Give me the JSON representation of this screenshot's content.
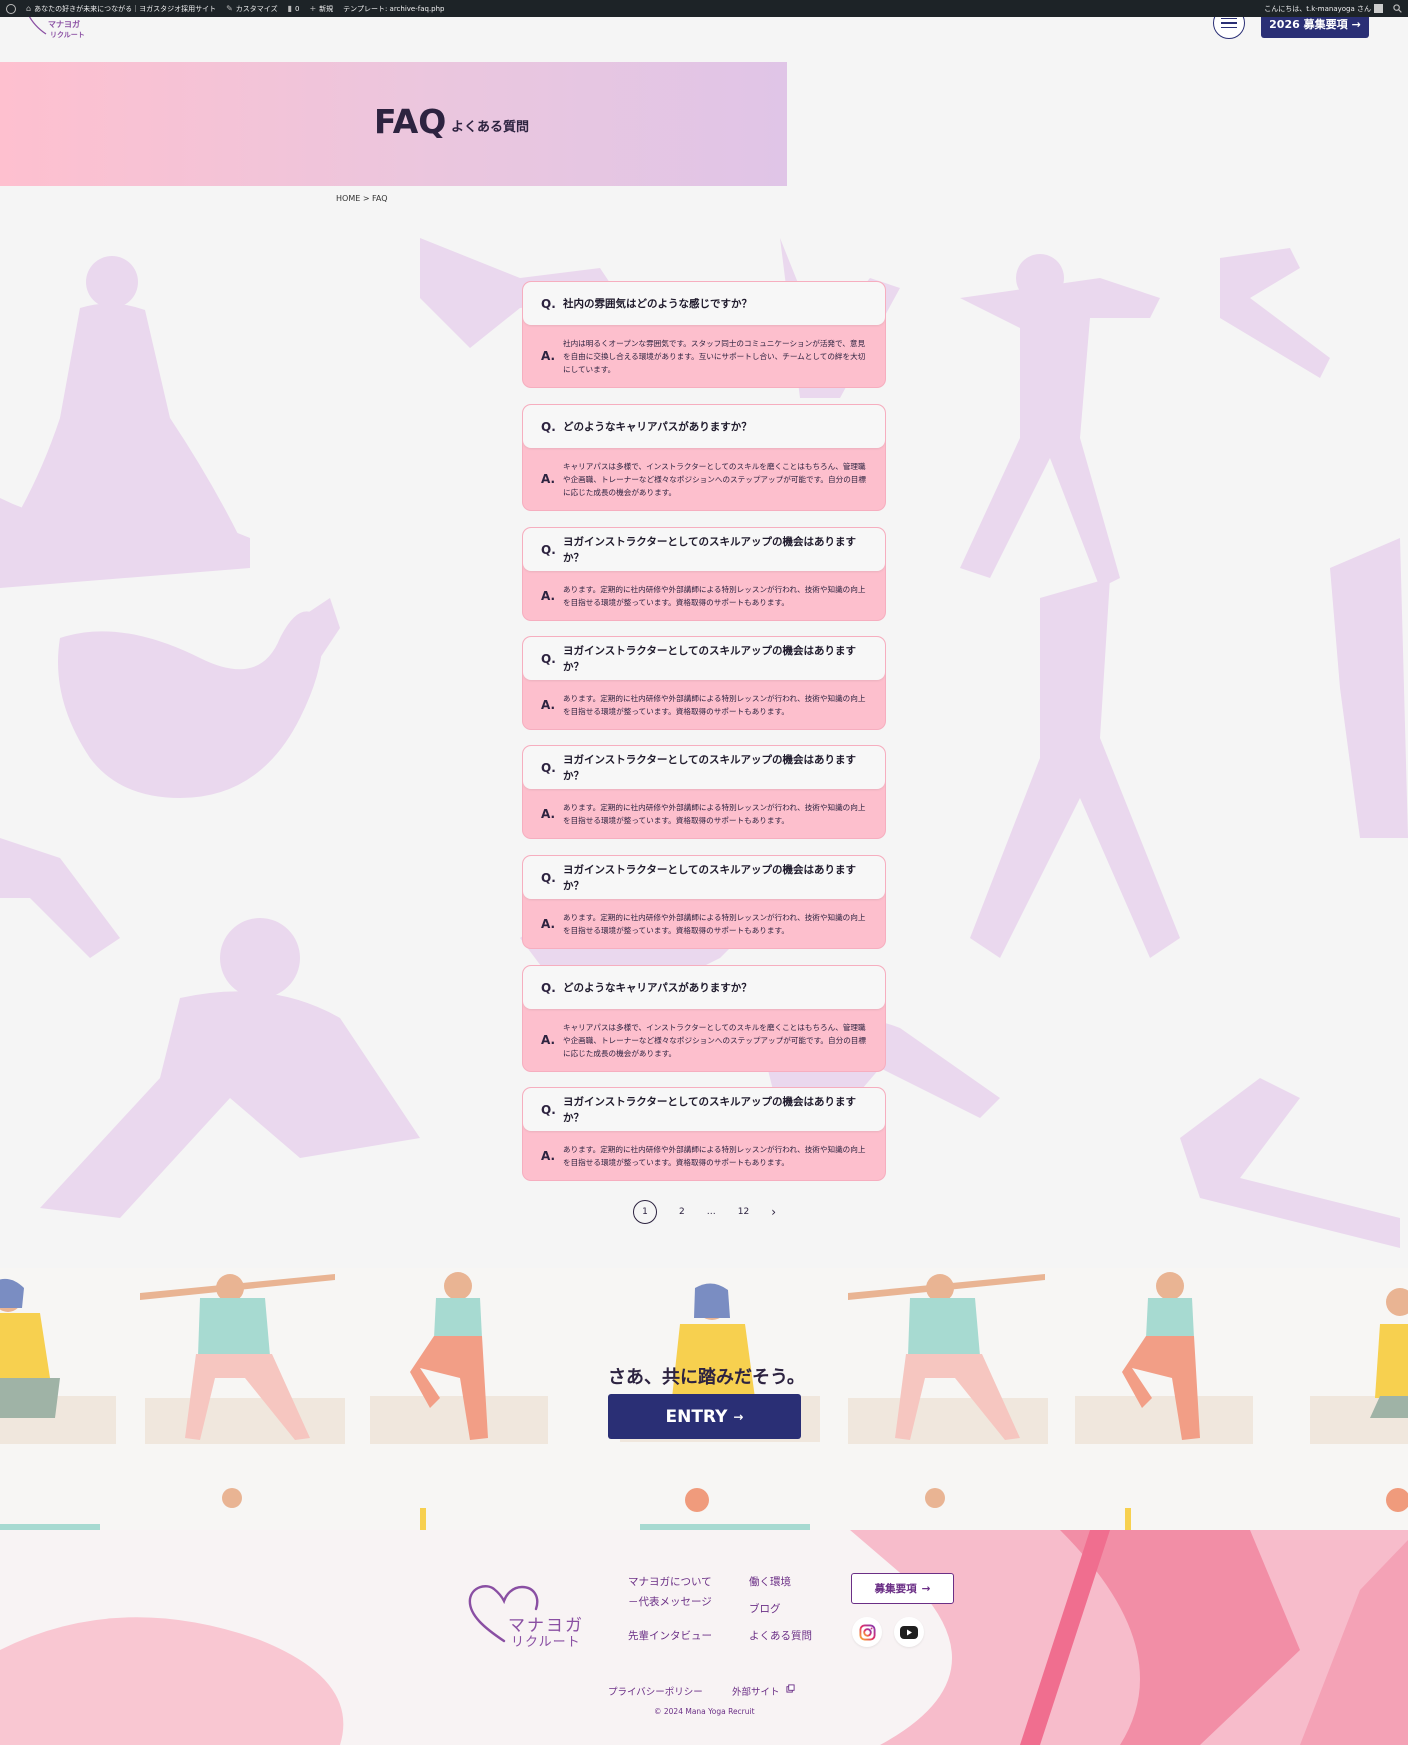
{
  "admin_bar": {
    "site_title": "あなたの好きが未来につながる｜ヨガスタジオ採用サイト",
    "customize": "カスタマイズ",
    "comments_count": "0",
    "new": "新規",
    "template": "テンプレート: archive-faq.php",
    "greeting": "こんにちは、t.k-manayoga さん"
  },
  "header": {
    "logo_line1": "マナヨガ",
    "logo_line2": "リクルート",
    "recruit_button": "2026 募集要項",
    "recruit_arrow": "→"
  },
  "hero": {
    "title": "FAQ",
    "subtitle": "よくある質問"
  },
  "breadcrumb": "HOME > FAQ",
  "faq": [
    {
      "q": "社内の雰囲気はどのような感じですか？",
      "a": "社内は明るくオープンな雰囲気です。スタッフ同士のコミュニケーションが活発で、意見を自由に交換し合える環境があります。互いにサポートし合い、チームとしての絆を大切にしています。"
    },
    {
      "q": "どのようなキャリアパスがありますか？",
      "a": "キャリアパスは多様で、インストラクターとしてのスキルを磨くことはもちろん、管理職や企画職、トレーナーなど様々なポジションへのステップアップが可能です。自分の目標に応じた成長の機会があります。"
    },
    {
      "q": "ヨガインストラクターとしてのスキルアップの機会はありますか？",
      "a": "あります。定期的に社内研修や外部講師による特別レッスンが行われ、技術や知識の向上を目指せる環境が整っています。資格取得のサポートもあります。"
    },
    {
      "q": "ヨガインストラクターとしてのスキルアップの機会はありますか？",
      "a": "あります。定期的に社内研修や外部講師による特別レッスンが行われ、技術や知識の向上を目指せる環境が整っています。資格取得のサポートもあります。"
    },
    {
      "q": "ヨガインストラクターとしてのスキルアップの機会はありますか？",
      "a": "あります。定期的に社内研修や外部講師による特別レッスンが行われ、技術や知識の向上を目指せる環境が整っています。資格取得のサポートもあります。"
    },
    {
      "q": "ヨガインストラクターとしてのスキルアップの機会はありますか？",
      "a": "あります。定期的に社内研修や外部講師による特別レッスンが行われ、技術や知識の向上を目指せる環境が整っています。資格取得のサポートもあります。"
    },
    {
      "q": "どのようなキャリアパスがありますか？",
      "a": "キャリアパスは多様で、インストラクターとしてのスキルを磨くことはもちろん、管理職や企画職、トレーナーなど様々なポジションへのステップアップが可能です。自分の目標に応じた成長の機会があります。"
    },
    {
      "q": "ヨガインストラクターとしてのスキルアップの機会はありますか？",
      "a": "あります。定期的に社内研修や外部講師による特別レッスンが行われ、技術や知識の向上を目指せる環境が整っています。資格取得のサポートもあります。"
    }
  ],
  "qa_marks": {
    "q": "Q.",
    "a": "A."
  },
  "pagination": {
    "current": "1",
    "page2": "2",
    "ellipsis": "…",
    "last": "12",
    "next": "›"
  },
  "entry": {
    "catch": "さあ、共に踏みだそう。",
    "button": "ENTRY",
    "arrow": "→"
  },
  "footer": {
    "logo_line1": "マナヨガ",
    "logo_line2": "リクルート",
    "links": {
      "about": "マナヨガについて",
      "message": "－代表メッセージ",
      "interview": "先輩インタビュー",
      "environment": "働く環境",
      "blog": "ブログ",
      "faq": "よくある質問"
    },
    "recruit_button": "募集要項",
    "recruit_arrow": "→",
    "privacy": "プライバシーポリシー",
    "external": "外部サイト",
    "copyright": "© 2024 Mana Yoga Recruit"
  },
  "colors": {
    "navy": "#2a2f75",
    "pink": "#fdbfcd",
    "purple": "#6b2f86",
    "silhouette": "#e7d3ec"
  }
}
